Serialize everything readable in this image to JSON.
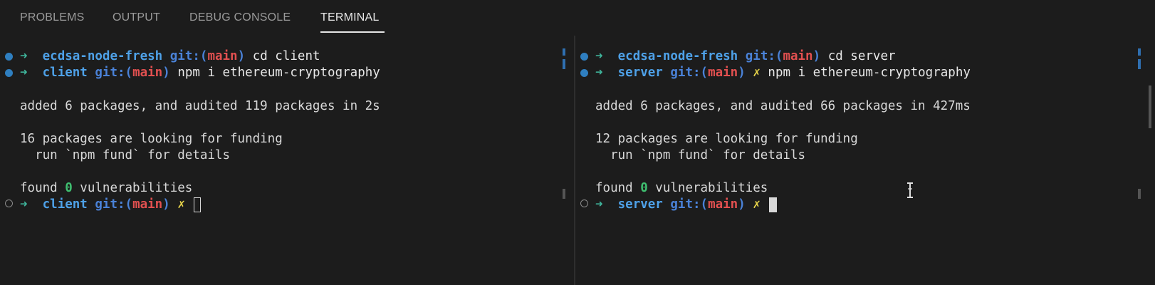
{
  "panel_tabs": [
    {
      "label": "PROBLEMS",
      "active": false
    },
    {
      "label": "OUTPUT",
      "active": false
    },
    {
      "label": "DEBUG CONSOLE",
      "active": false
    },
    {
      "label": "TERMINAL",
      "active": true
    }
  ],
  "colors": {
    "background": "#1c1c1c",
    "arrow": "#3fb49b",
    "directory": "#4ea1e8",
    "git_prefix": "#4a82d8",
    "branch": "#e25050",
    "dirty_marker": "#e6d34a",
    "zero_count": "#3fbf70"
  },
  "terminals": {
    "left": {
      "line1": {
        "arrow": "➜",
        "dir": "ecdsa-node-fresh",
        "git": "git:(",
        "branch": "main",
        "git_close": ")",
        "command": "cd client"
      },
      "line2": {
        "arrow": "➜",
        "dir": "client",
        "git": "git:(",
        "branch": "main",
        "git_close": ")",
        "command": "npm i ethereum-cryptography"
      },
      "output": {
        "added": "added 6 packages, and audited 119 packages in 2s",
        "funding": "16 packages are looking for funding",
        "fund_hint": "  run `npm fund` for details",
        "found_prefix": "found ",
        "found_zero": "0",
        "found_suffix": " vulnerabilities"
      },
      "prompt": {
        "arrow": "➜",
        "dir": "client",
        "git": "git:(",
        "branch": "main",
        "git_close": ")",
        "dirty": "✗"
      }
    },
    "right": {
      "line1": {
        "arrow": "➜",
        "dir": "ecdsa-node-fresh",
        "git": "git:(",
        "branch": "main",
        "git_close": ")",
        "command": "cd server"
      },
      "line2": {
        "arrow": "➜",
        "dir": "server",
        "git": "git:(",
        "branch": "main",
        "git_close": ")",
        "dirty": "✗",
        "command": "npm i ethereum-cryptography"
      },
      "output": {
        "added": "added 6 packages, and audited 66 packages in 427ms",
        "funding": "12 packages are looking for funding",
        "fund_hint": "  run `npm fund` for details",
        "found_prefix": "found ",
        "found_zero": "0",
        "found_suffix": " vulnerabilities"
      },
      "prompt": {
        "arrow": "➜",
        "dir": "server",
        "git": "git:(",
        "branch": "main",
        "git_close": ")",
        "dirty": "✗"
      }
    }
  }
}
